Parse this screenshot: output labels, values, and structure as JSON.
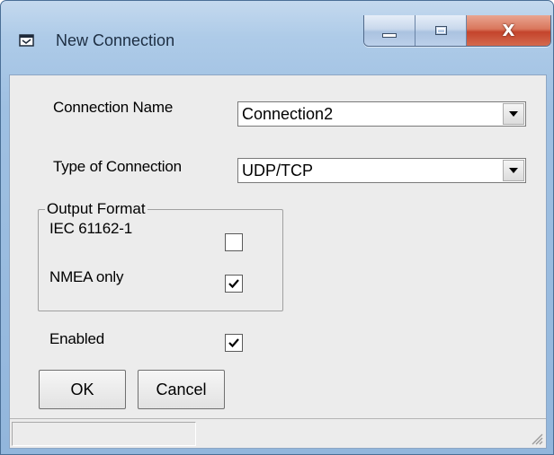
{
  "window": {
    "title": "New Connection",
    "icon": "window-app-icon"
  },
  "caption_buttons": {
    "minimize": "minimize-icon",
    "maximize": "maximize-icon",
    "close": "close-icon",
    "close_glyph": "X"
  },
  "form": {
    "connection_name": {
      "label": "Connection Name",
      "value": "Connection2"
    },
    "connection_type": {
      "label": "Type of Connection",
      "value": "UDP/TCP"
    },
    "output_format": {
      "legend": "Output Format",
      "options": [
        {
          "label": "IEC 61162-1",
          "checked": false
        },
        {
          "label": "NMEA only",
          "checked": true
        }
      ]
    },
    "enabled": {
      "label": "Enabled",
      "checked": true
    }
  },
  "buttons": {
    "ok": "OK",
    "cancel": "Cancel"
  },
  "statusbar": {
    "text": ""
  },
  "colors": {
    "frame": "#aecbe8",
    "client": "#ececec",
    "close_button": "#c4442c"
  }
}
